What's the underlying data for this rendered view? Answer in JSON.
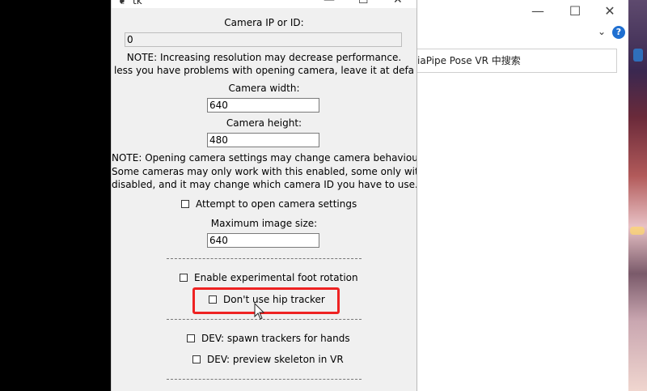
{
  "tk_window": {
    "title": "tk",
    "title_icon": "feather-icon",
    "controls": [
      "—",
      "☐",
      "✕"
    ],
    "camera_ip_label": "Camera IP or ID:",
    "camera_ip_value": "0",
    "note_resolution_line1": "NOTE: Increasing resolution may decrease performance.",
    "note_resolution_line2": "less you have problems with opening camera, leave it at defa",
    "camera_width_label": "Camera width:",
    "camera_width_value": "640",
    "camera_height_label": "Camera height:",
    "camera_height_value": "480",
    "note_settings_line1": "NOTE: Opening camera settings may change camera behaviour.",
    "note_settings_line2": "Some cameras may only work with this enabled, some only with this",
    "note_settings_line3": "disabled, and it may change which camera ID you have to use.",
    "checkbox_camera_settings": "Attempt to open camera settings",
    "max_image_size_label": "Maximum image size:",
    "max_image_size_value": "640",
    "checkbox_foot_rotation": "Enable experimental foot rotation",
    "checkbox_hip_tracker": "Don't use hip tracker",
    "checkbox_spawn_hands": "DEV: spawn trackers for hands",
    "checkbox_preview_skeleton": "DEV: preview skeleton in VR"
  },
  "background_window": {
    "controls": [
      "—",
      "☐",
      "✕"
    ],
    "search_text": "iaPipe Pose VR 中搜索",
    "help_label": "?",
    "chevron": "⌄"
  },
  "colors": {
    "highlight_border": "#e22222",
    "tk_background": "#f0f0f0",
    "help_blue": "#1f6fd1"
  }
}
